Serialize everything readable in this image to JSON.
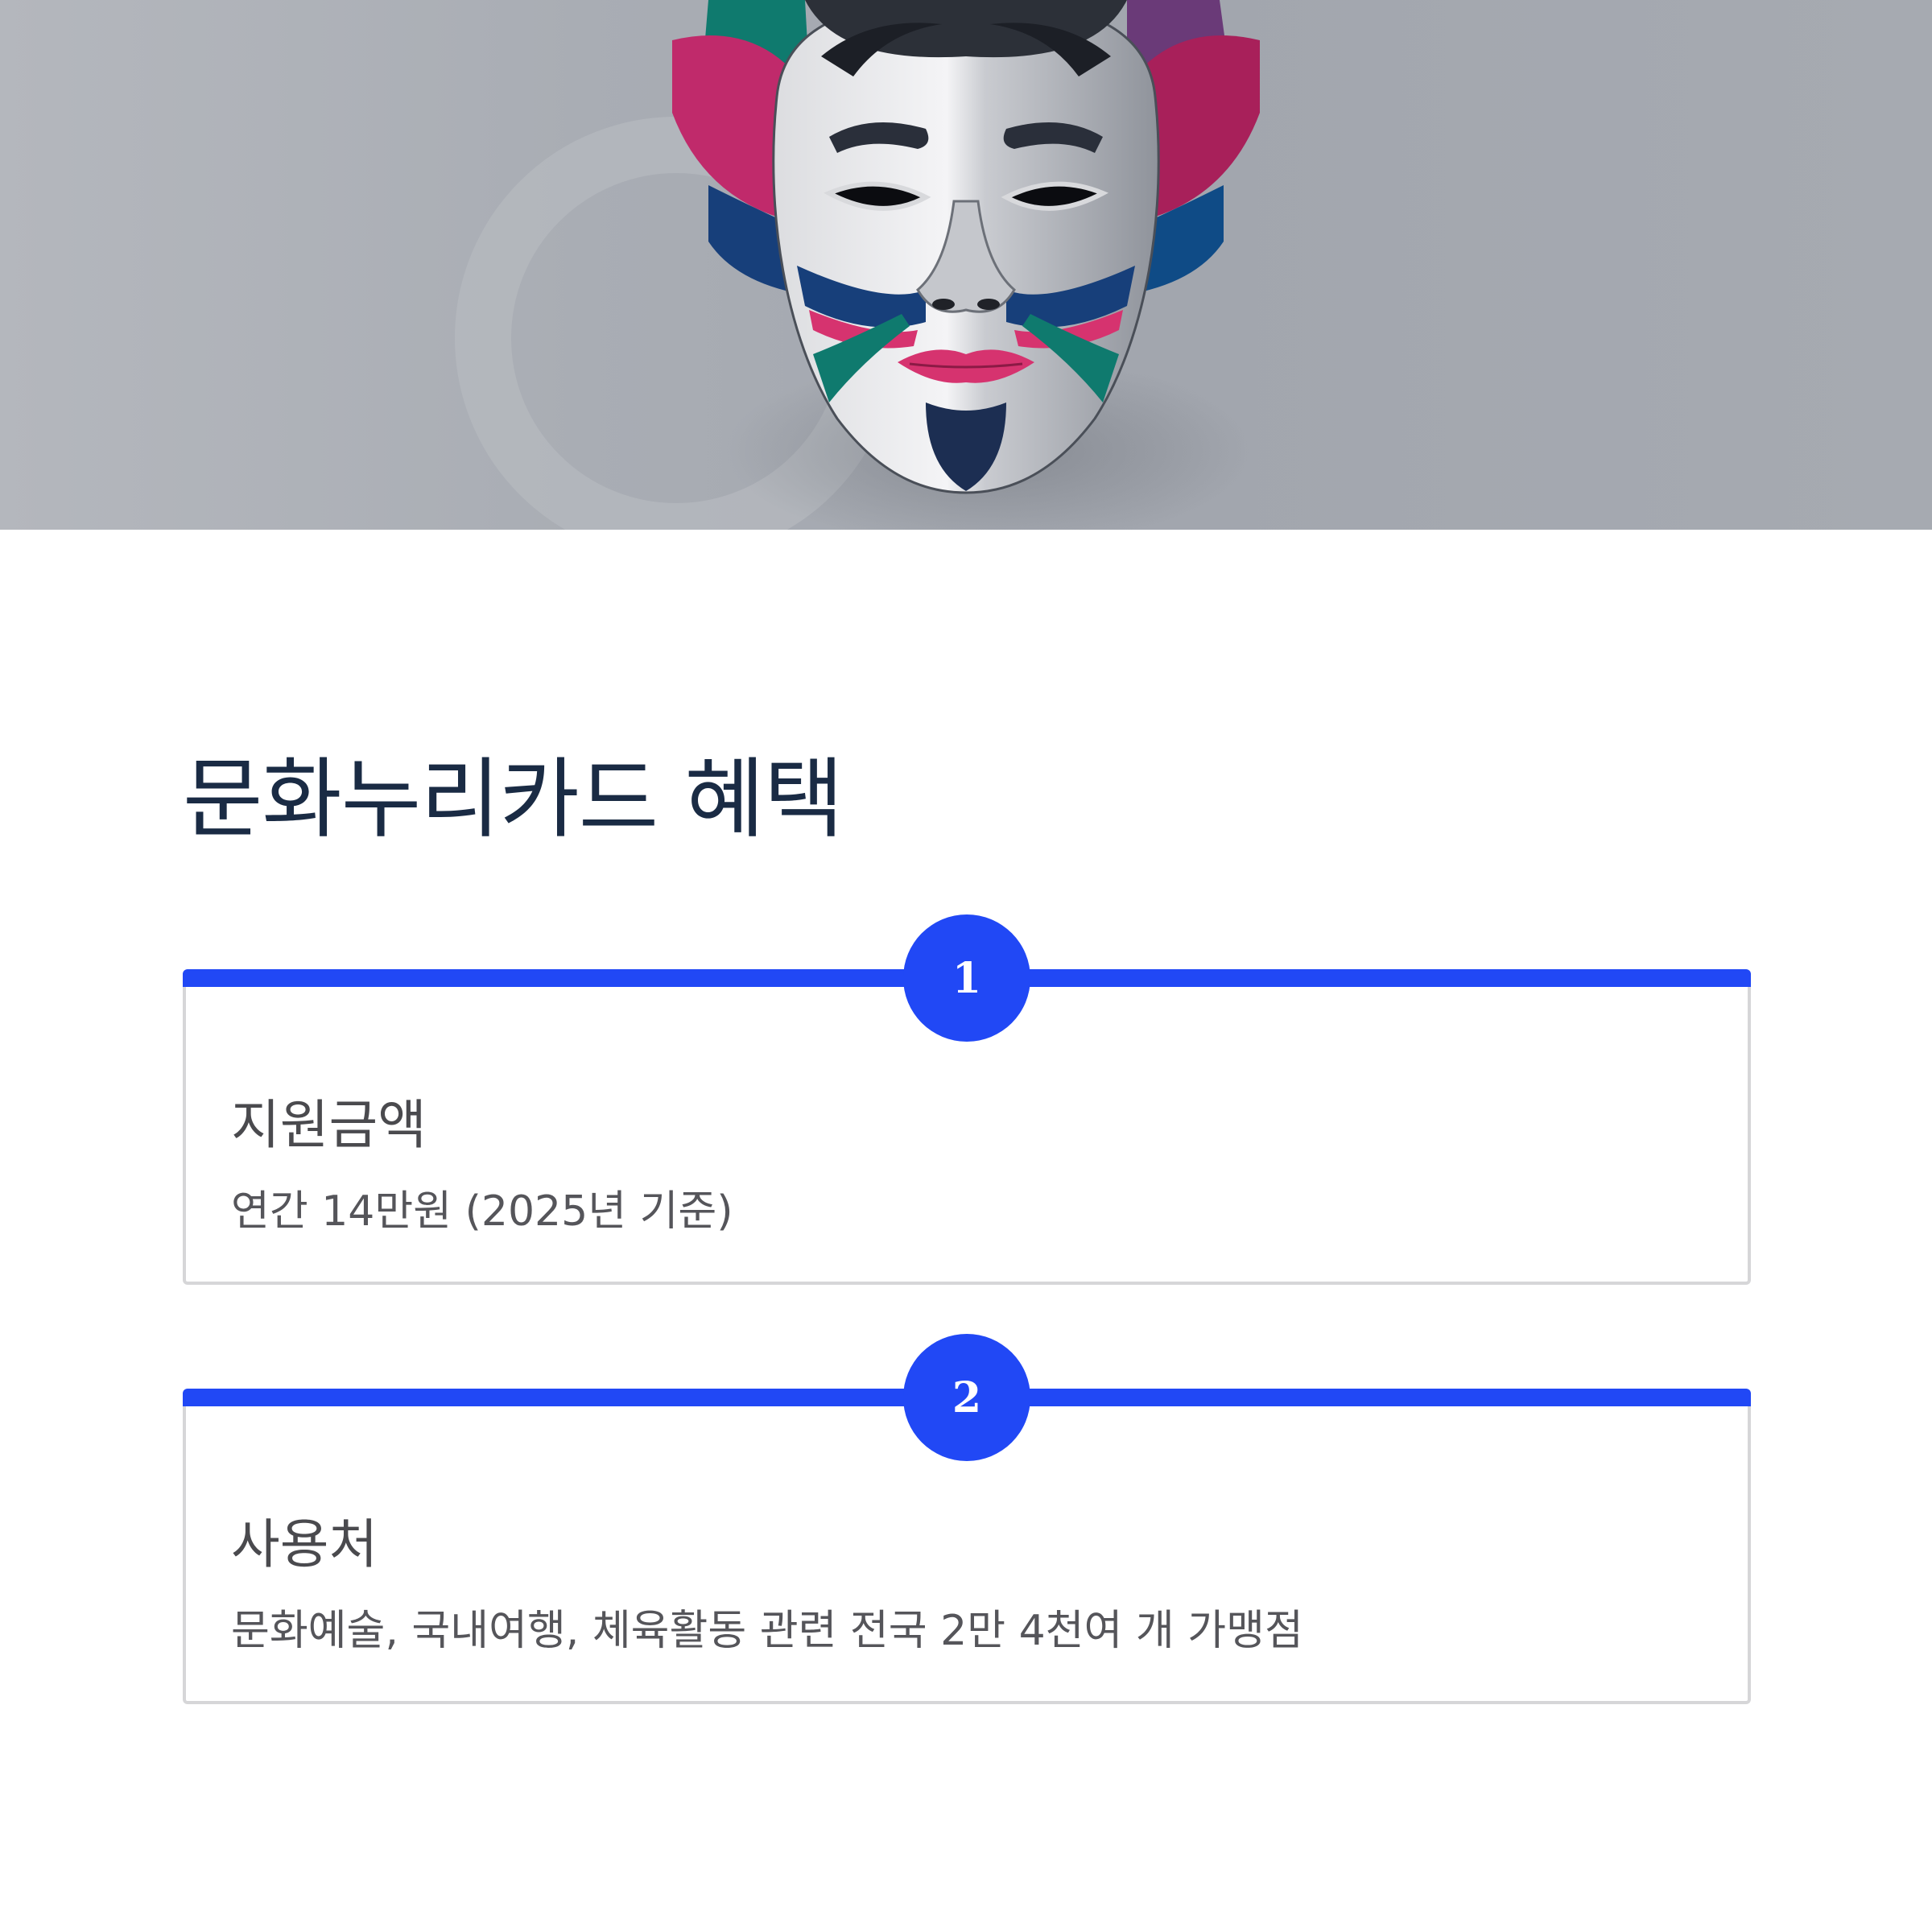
{
  "page": {
    "title": "문화누리카드 혜택"
  },
  "colors": {
    "accent": "#2148f5",
    "title_text": "#1a2b44",
    "body_text": "#4a4a4e",
    "card_border": "#d6d6d8",
    "hero_background": "#a9adb4"
  },
  "hero": {
    "icon": "korean-traditional-mask"
  },
  "benefits": [
    {
      "number": "1",
      "title": "지원금액",
      "description": "연간 14만원 (2025년 기준)"
    },
    {
      "number": "2",
      "title": "사용처",
      "description": "문화예술, 국내여행, 체육활동 관련 전국 2만 4천여 개 가맹점"
    }
  ]
}
